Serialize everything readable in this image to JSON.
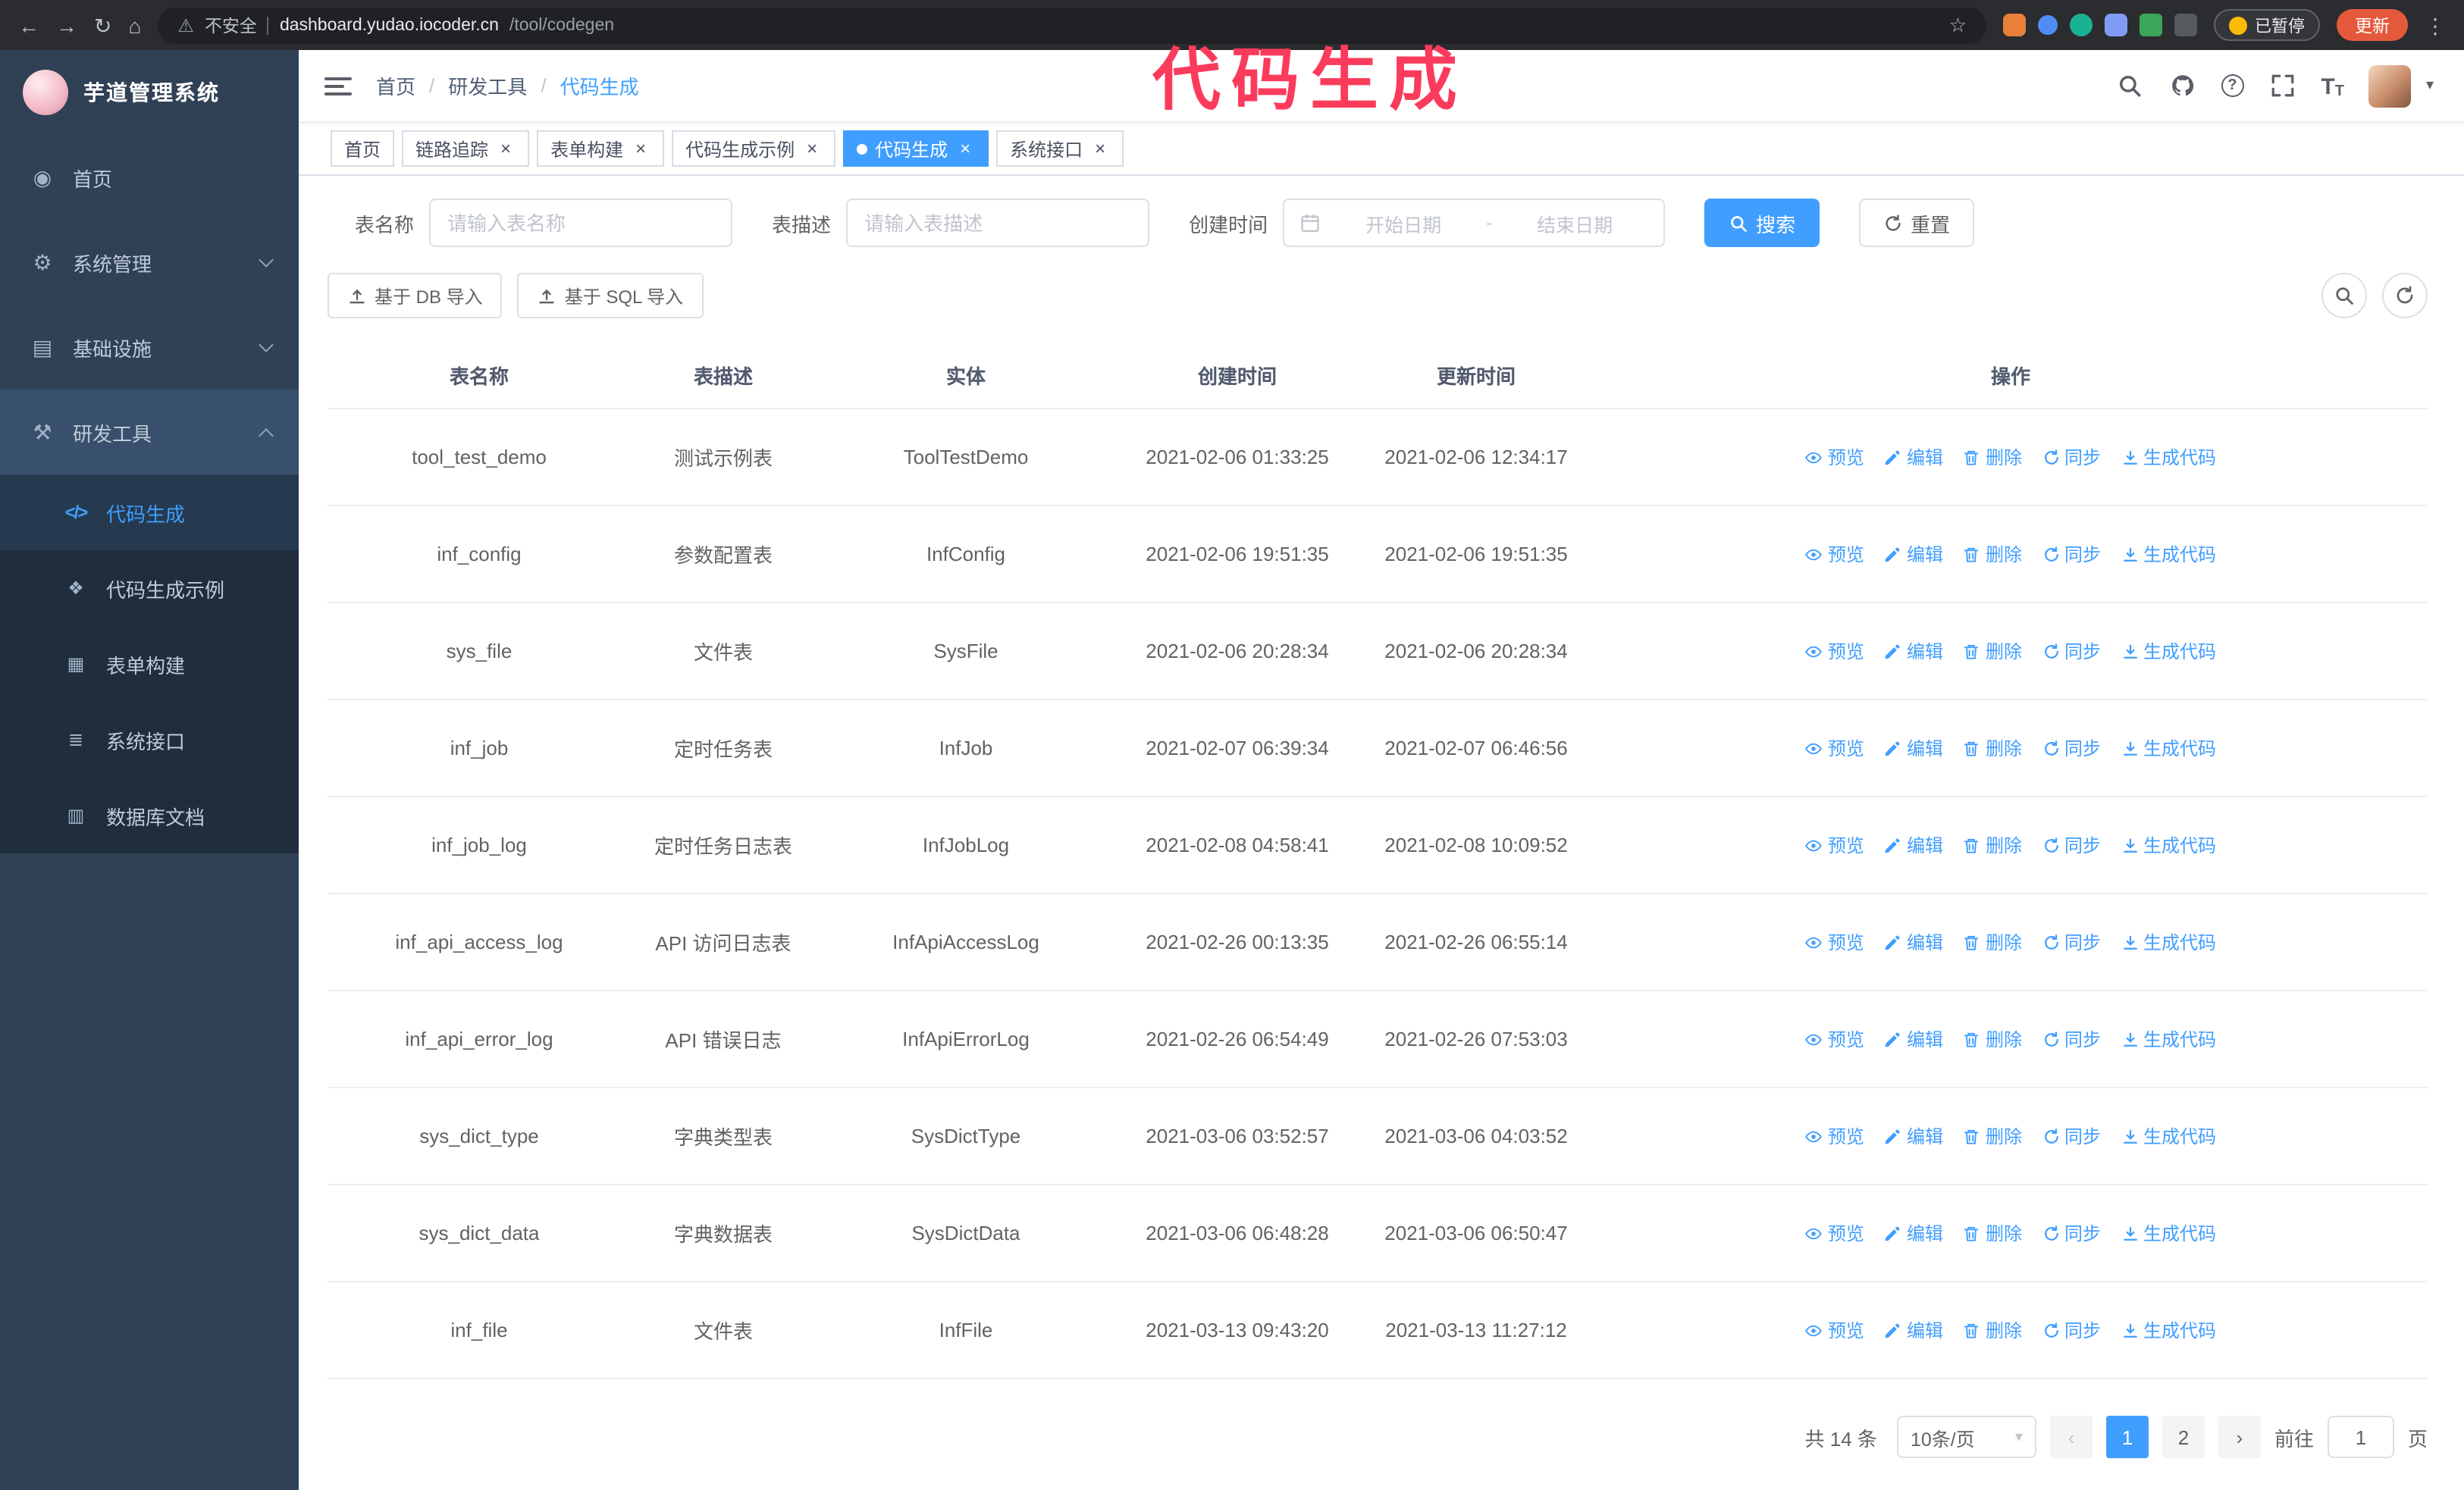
{
  "annotation": {
    "text": "代码生成"
  },
  "browser": {
    "security_label": "不安全",
    "url_domain": "dashboard.yudao.iocoder.cn",
    "url_path": "/tool/codegen",
    "paused_badge": "已暂停",
    "update_button": "更新"
  },
  "icons": {
    "back": "←",
    "forward": "→",
    "reload": "↻",
    "home": "⌂",
    "warning": "⚠",
    "star": "☆",
    "more": "⋮",
    "close": "×",
    "slash": "/",
    "question": "?",
    "caret": "▾",
    "chevron_left": "‹",
    "chevron_right": "›",
    "font_size": "T"
  },
  "sidebar": {
    "logo_title": "芋道管理系统",
    "items": [
      {
        "label": "首页",
        "glyph": "◉"
      },
      {
        "label": "系统管理",
        "glyph": "⚙"
      },
      {
        "label": "基础设施",
        "glyph": "▤"
      },
      {
        "label": "研发工具",
        "glyph": "⚒"
      }
    ],
    "submenu": [
      {
        "label": "代码生成",
        "glyph": "</>"
      },
      {
        "label": "代码生成示例",
        "glyph": "❖"
      },
      {
        "label": "表单构建",
        "glyph": "▦"
      },
      {
        "label": "系统接口",
        "glyph": "≣"
      },
      {
        "label": "数据库文档",
        "glyph": "▥"
      }
    ]
  },
  "breadcrumb": [
    "首页",
    "研发工具",
    "代码生成"
  ],
  "tabs": [
    {
      "label": "首页"
    },
    {
      "label": "链路追踪"
    },
    {
      "label": "表单构建"
    },
    {
      "label": "代码生成示例"
    },
    {
      "label": "代码生成"
    },
    {
      "label": "系统接口"
    }
  ],
  "search_form": {
    "table_name_label": "表名称",
    "table_name_placeholder": "请输入表名称",
    "table_desc_label": "表描述",
    "table_desc_placeholder": "请输入表描述",
    "create_time_label": "创建时间",
    "start_date_placeholder": "开始日期",
    "range_separator": "-",
    "end_date_placeholder": "结束日期",
    "search_button": "搜索",
    "reset_button": "重置"
  },
  "toolbar": {
    "import_db_button": "基于 DB 导入",
    "import_sql_button": "基于 SQL 导入"
  },
  "table": {
    "columns": [
      "表名称",
      "表描述",
      "实体",
      "创建时间",
      "更新时间",
      "操作"
    ],
    "op_labels": {
      "preview": "预览",
      "edit": "编辑",
      "delete": "删除",
      "sync": "同步",
      "generate": "生成代码"
    },
    "rows": [
      {
        "name": "tool_test_demo",
        "desc": "测试示例表",
        "entity": "ToolTestDemo",
        "create_time": "2021-02-06 01:33:25",
        "update_time": "2021-02-06 12:34:17"
      },
      {
        "name": "inf_config",
        "desc": "参数配置表",
        "entity": "InfConfig",
        "create_time": "2021-02-06 19:51:35",
        "update_time": "2021-02-06 19:51:35"
      },
      {
        "name": "sys_file",
        "desc": "文件表",
        "entity": "SysFile",
        "create_time": "2021-02-06 20:28:34",
        "update_time": "2021-02-06 20:28:34"
      },
      {
        "name": "inf_job",
        "desc": "定时任务表",
        "entity": "InfJob",
        "create_time": "2021-02-07 06:39:34",
        "update_time": "2021-02-07 06:46:56"
      },
      {
        "name": "inf_job_log",
        "desc": "定时任务日志表",
        "entity": "InfJobLog",
        "create_time": "2021-02-08 04:58:41",
        "update_time": "2021-02-08 10:09:52"
      },
      {
        "name": "inf_api_access_log",
        "desc": "API 访问日志表",
        "entity": "InfApiAccessLog",
        "create_time": "2021-02-26 00:13:35",
        "update_time": "2021-02-26 06:55:14"
      },
      {
        "name": "inf_api_error_log",
        "desc": "API 错误日志",
        "entity": "InfApiErrorLog",
        "create_time": "2021-02-26 06:54:49",
        "update_time": "2021-02-26 07:53:03"
      },
      {
        "name": "sys_dict_type",
        "desc": "字典类型表",
        "entity": "SysDictType",
        "create_time": "2021-03-06 03:52:57",
        "update_time": "2021-03-06 04:03:52"
      },
      {
        "name": "sys_dict_data",
        "desc": "字典数据表",
        "entity": "SysDictData",
        "create_time": "2021-03-06 06:48:28",
        "update_time": "2021-03-06 06:50:47"
      },
      {
        "name": "inf_file",
        "desc": "文件表",
        "entity": "InfFile",
        "create_time": "2021-03-13 09:43:20",
        "update_time": "2021-03-13 11:27:12"
      }
    ]
  },
  "pagination": {
    "total_text": "共 14 条",
    "page_size": "10条/页",
    "pages": [
      "1",
      "2"
    ],
    "active_page": "1",
    "goto_label": "前往",
    "goto_value": "1",
    "goto_suffix": "页"
  },
  "colors": {
    "accent": "#409eff",
    "sidebar_bg": "#304156",
    "submenu_bg": "#1f2d3d",
    "annotation": "#fb3b5c",
    "update_button": "#e4593b"
  }
}
